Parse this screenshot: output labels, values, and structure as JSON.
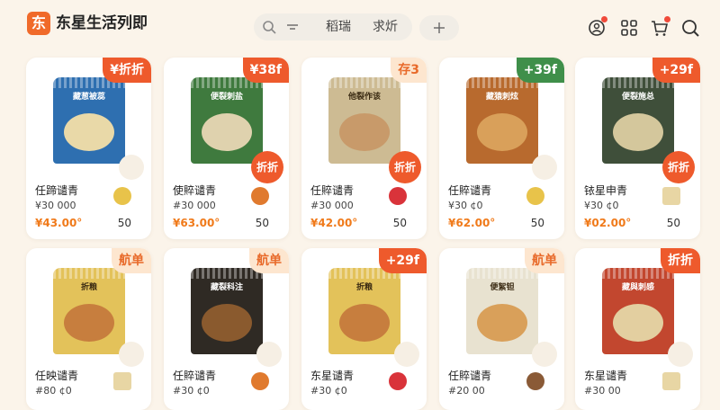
{
  "app": {
    "logo_char": "东",
    "title": "东星生活列即"
  },
  "search": {
    "tab1": "稻瑞",
    "tab2": "求炘"
  },
  "colors": {
    "accent": "#f06a2a",
    "price": "#f07a1a",
    "badge": "#ee5a2c",
    "background": "#fbf4ea"
  },
  "icons": [
    "search-icon",
    "filter-icon",
    "add-icon",
    "user-share-icon",
    "grid-icon",
    "cart-icon",
    "search-chat-icon"
  ],
  "products": [
    {
      "name": "任蹄谴青",
      "spec": "¥30 000",
      "price": "¥43.00°",
      "stock": "50",
      "tag": "¥折折",
      "burst": "",
      "brand": "藏葱被蕊",
      "pkg_color": "#2e6fb0",
      "food_color": "#e9d9a8",
      "thumb": "ginger-icon"
    },
    {
      "name": "使賥谴青",
      "spec": "#30 000",
      "price": "¥63.00°",
      "stock": "50",
      "tag": "¥38f",
      "burst": "折折",
      "brand": "便裂刺盐",
      "pkg_color": "#3f7a3e",
      "food_color": "#dfd2ae",
      "thumb": "onion-icon"
    },
    {
      "name": "任賥谴青",
      "spec": "#30 000",
      "price": "¥42.00°",
      "stock": "50",
      "tag": "存3",
      "burst": "折折",
      "brand": "他裂作该",
      "pkg_color": "#cdbb93",
      "food_color": "#c89a6a",
      "thumb": "strawberry-icon"
    },
    {
      "name": "任賥谴青",
      "spec": "¥30 ¢0",
      "price": "¥62.00°",
      "stock": "50",
      "tag": "+39f",
      "burst": "",
      "brand": "藏猿刺炫",
      "pkg_color": "#b86a2e",
      "food_color": "#d9a05a",
      "thumb": "ginger-icon"
    },
    {
      "name": "铱星申青",
      "spec": "¥30 ¢0",
      "price": "¥02.00°",
      "stock": "50",
      "tag": "+29f",
      "burst": "折折",
      "brand": "便裂施总",
      "pkg_color": "#3f4f3a",
      "food_color": "#d4c79c",
      "thumb": "tofu-icon"
    },
    {
      "name": "任映谴青",
      "spec": "#80 ¢0",
      "price": "",
      "stock": "",
      "tag": "航单",
      "burst": "",
      "brand": "折粮",
      "pkg_color": "#e3c25a",
      "food_color": "#c77e3e",
      "thumb": "tofu-icon"
    },
    {
      "name": "任賥谴青",
      "spec": "#30 ¢0",
      "price": "",
      "stock": "",
      "tag": "航单",
      "burst": "",
      "brand": "藏裂科注",
      "pkg_color": "#2f2a24",
      "food_color": "#8a5a2e",
      "thumb": "onion-icon"
    },
    {
      "name": "东星谴青",
      "spec": "#30 ¢0",
      "price": "",
      "stock": "",
      "tag": "+29f",
      "burst": "",
      "brand": "折粮",
      "pkg_color": "#e3c25a",
      "food_color": "#c77e3e",
      "thumb": "strawberry-icon"
    },
    {
      "name": "任賥谴青",
      "spec": "#20 00",
      "price": "",
      "stock": "",
      "tag": "航单",
      "burst": "",
      "brand": "便絮钽",
      "pkg_color": "#e8e2d0",
      "food_color": "#d9a05a",
      "thumb": "rice-bowl-icon"
    },
    {
      "name": "东星谴青",
      "spec": "#30 00",
      "price": "",
      "stock": "",
      "tag": "折折",
      "burst": "",
      "brand": "藏與刺感",
      "pkg_color": "#c2472f",
      "food_color": "#e3cfa0",
      "thumb": "tofu-icon"
    }
  ]
}
